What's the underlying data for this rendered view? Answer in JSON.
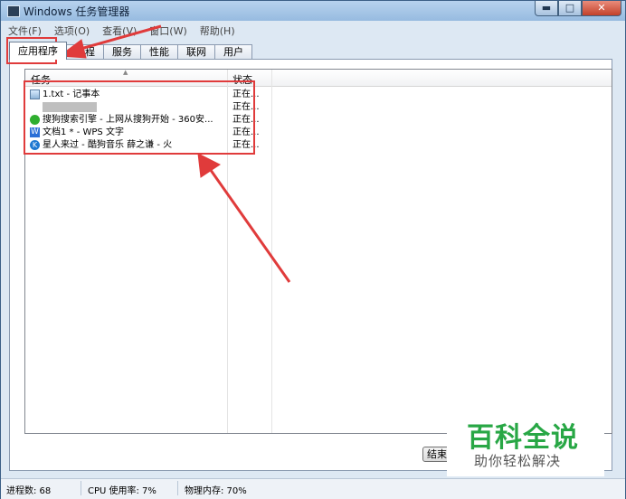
{
  "window": {
    "title": "Windows 任务管理器"
  },
  "window_buttons": {
    "minimize": "▬",
    "maximize": "□",
    "close": "✕"
  },
  "menu": [
    "文件(F)",
    "选项(O)",
    "查看(V)",
    "窗口(W)",
    "帮助(H)"
  ],
  "tabs": [
    "应用程序",
    "进程",
    "服务",
    "性能",
    "联网",
    "用户"
  ],
  "table": {
    "headers": {
      "task": "任务",
      "status": "状态"
    },
    "rows": [
      {
        "icon": "notepad-icon",
        "name": "1.txt - 记事本",
        "status": "正在..."
      },
      {
        "icon": "blurred-icon",
        "name": "",
        "status": "正在..."
      },
      {
        "icon": "sogou-browser-icon",
        "name": "搜狗搜索引擎 - 上网从搜狗开始 - 360安...",
        "status": "正在..."
      },
      {
        "icon": "wps-icon",
        "name": "文档1 * - WPS 文字",
        "status": "正在..."
      },
      {
        "icon": "kugou-icon",
        "name": "星人来过 - 酷狗音乐 薛之谦 - 火",
        "status": "正在..."
      }
    ]
  },
  "end_task_button": "结束任",
  "statusbar": {
    "processes": "进程数: 68",
    "cpu": "CPU 使用率: 7%",
    "memory": "物理内存: 70%"
  },
  "watermark": {
    "main": "百科全说",
    "sub": "助你轻松解决"
  },
  "colors": {
    "annotation": "#e03b3b",
    "watermark_green": "#28a745"
  }
}
